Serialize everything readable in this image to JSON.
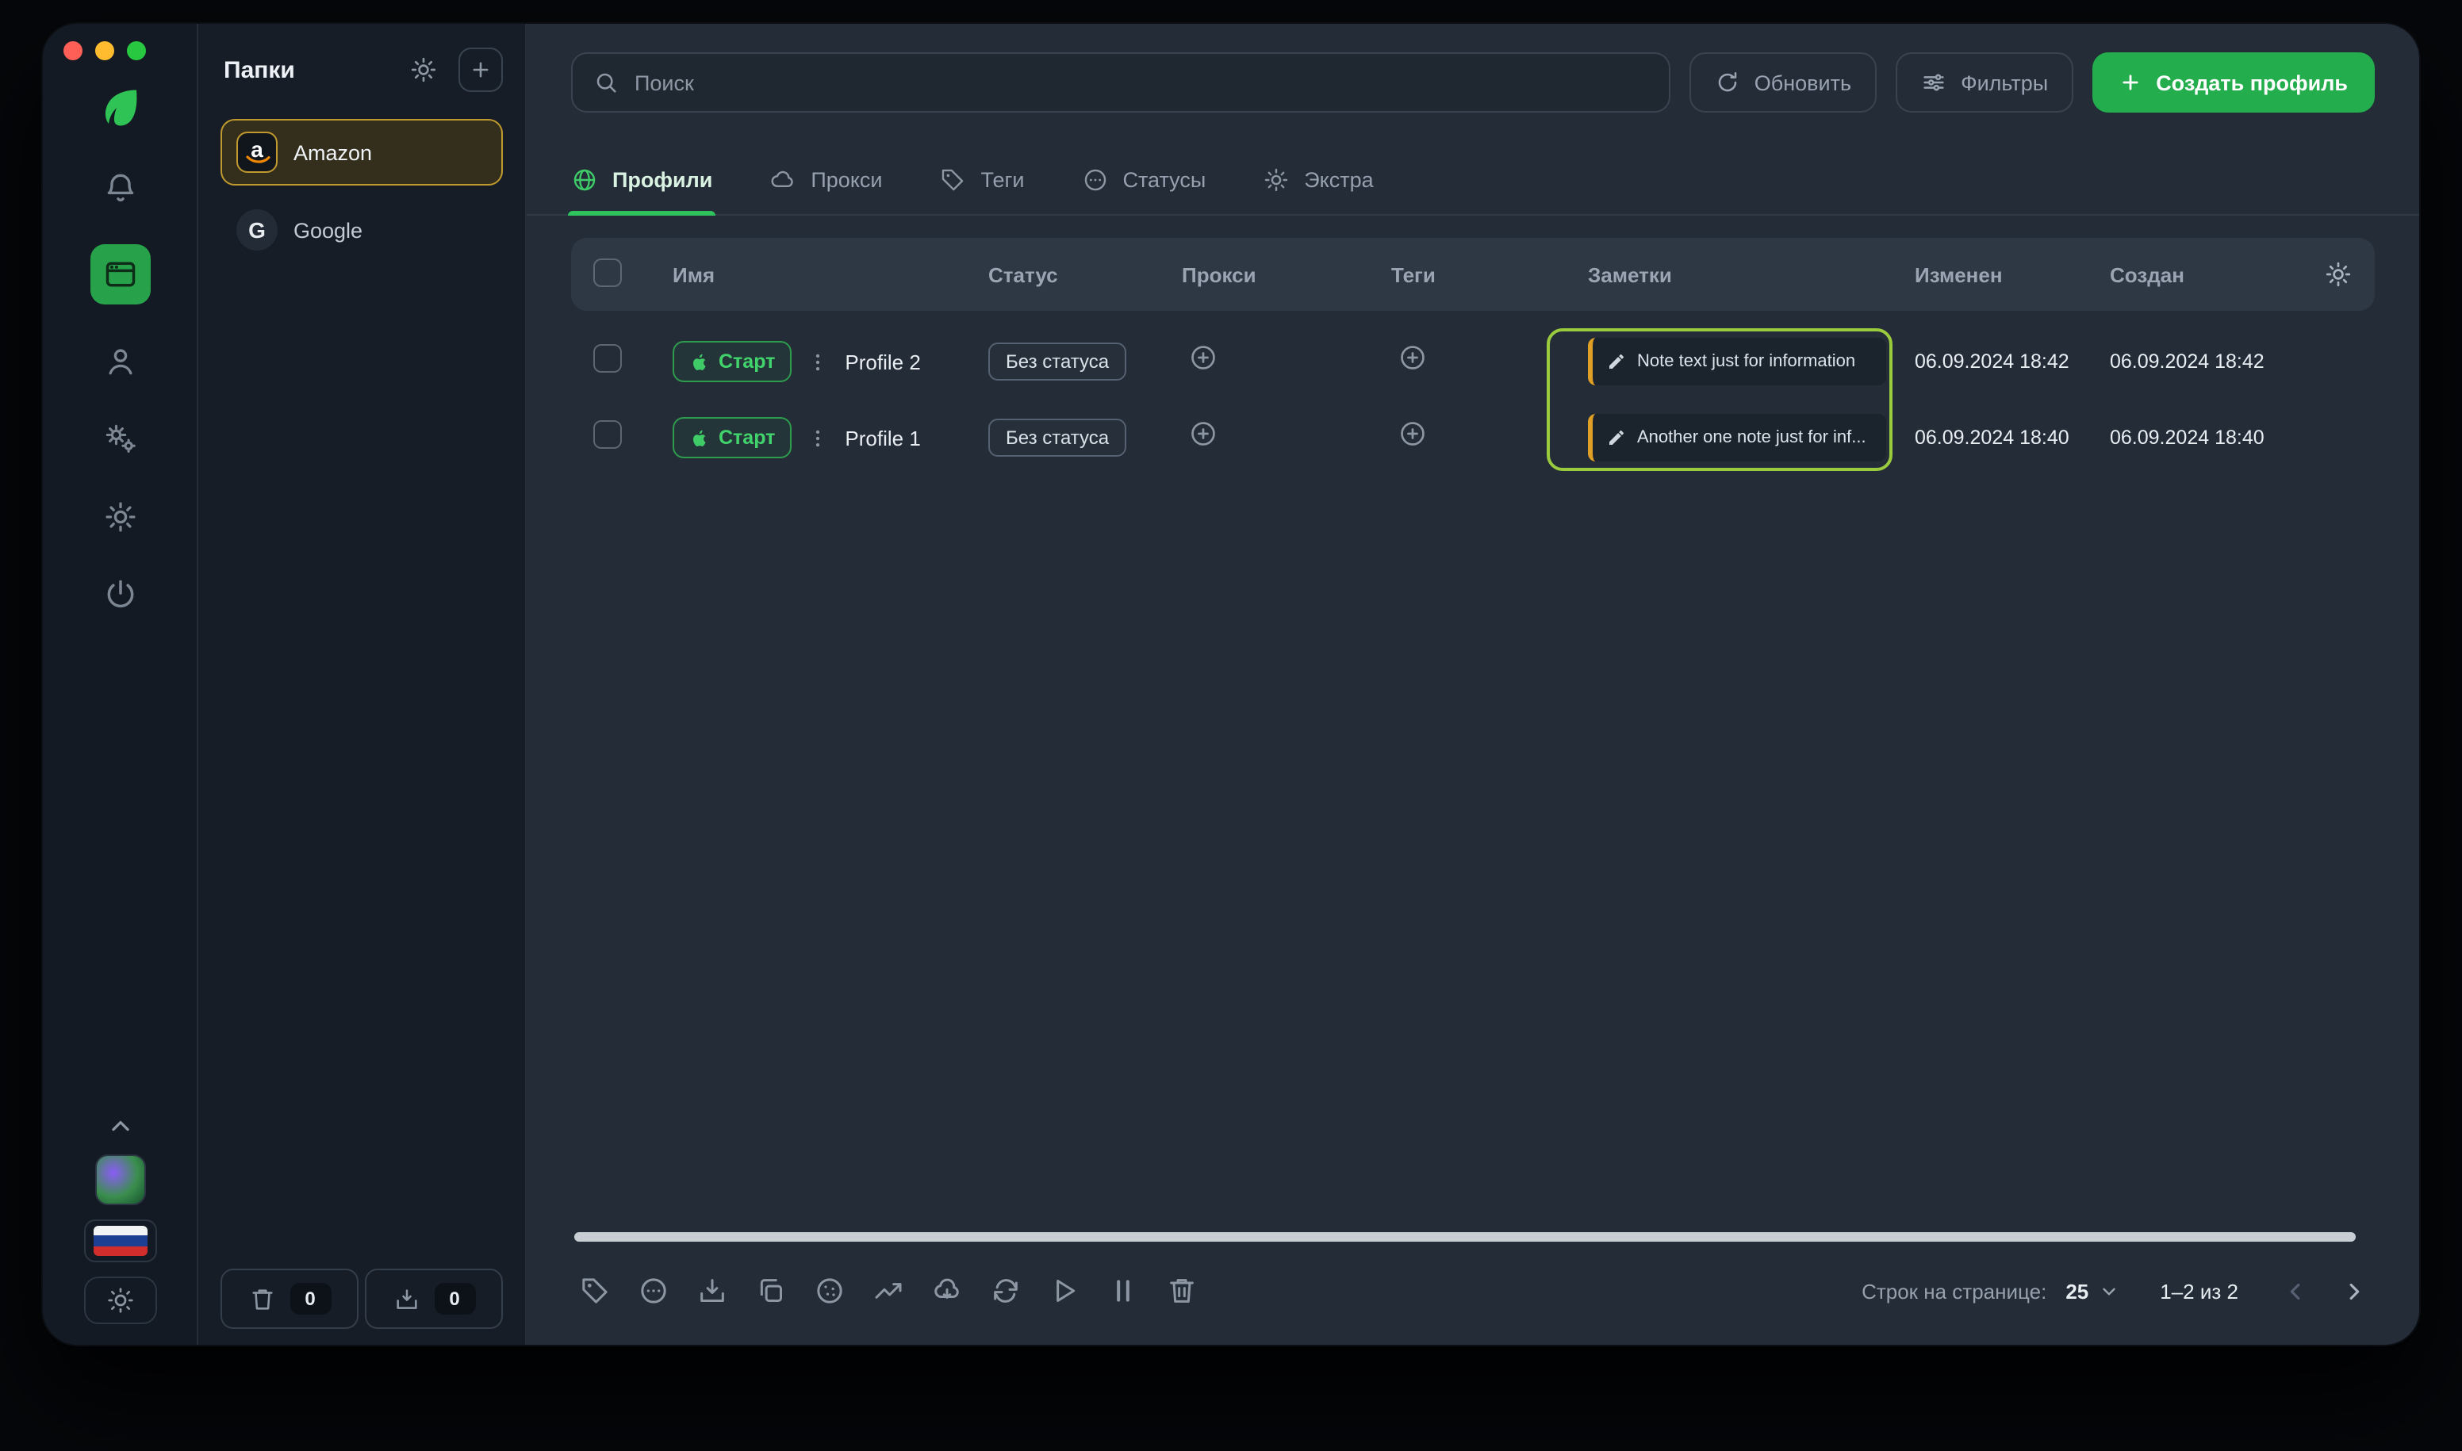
{
  "folders": {
    "title": "Папки",
    "items": [
      {
        "label": "Amazon",
        "icon_letter": "a",
        "selected": true
      },
      {
        "label": "Google",
        "icon_letter": "G",
        "selected": false
      }
    ],
    "trash_count": "0",
    "archive_count": "0"
  },
  "topbar": {
    "search_placeholder": "Поиск",
    "refresh_label": "Обновить",
    "filters_label": "Фильтры",
    "create_label": "Создать профиль"
  },
  "tabs": [
    {
      "label": "Профили",
      "active": true
    },
    {
      "label": "Прокси",
      "active": false
    },
    {
      "label": "Теги",
      "active": false
    },
    {
      "label": "Статусы",
      "active": false
    },
    {
      "label": "Экстра",
      "active": false
    }
  ],
  "table": {
    "columns": [
      "Имя",
      "Статус",
      "Прокси",
      "Теги",
      "Заметки",
      "Изменен",
      "Создан"
    ],
    "rows": [
      {
        "start_label": "Старт",
        "name": "Profile 2",
        "status": "Без статуса",
        "note": "Note text just for information",
        "modified": "06.09.2024 18:42",
        "created": "06.09.2024 18:42"
      },
      {
        "start_label": "Старт",
        "name": "Profile 1",
        "status": "Без статуса",
        "note": "Another one note just for inf...",
        "modified": "06.09.2024 18:40",
        "created": "06.09.2024 18:40"
      }
    ]
  },
  "footer": {
    "rows_per_page_label": "Строк на странице:",
    "rows_per_page": "25",
    "range": "1–2 из 2"
  },
  "colors": {
    "accent_green": "#23ad4d",
    "selection_green": "#9acb3f",
    "folder_gold": "#c09a2e",
    "note_orange": "#e09f27"
  }
}
